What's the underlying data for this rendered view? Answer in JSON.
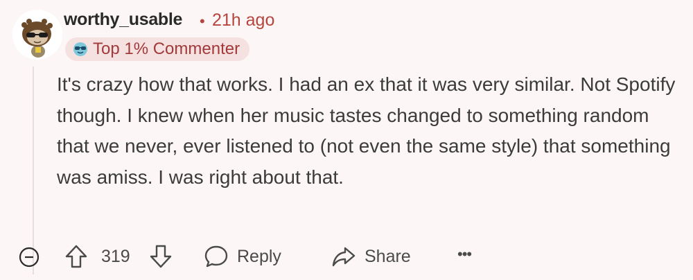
{
  "comment": {
    "username": "worthy_usable",
    "separator": "•",
    "timestamp": "21h ago",
    "flair": {
      "label": "Top 1% Commenter",
      "icon": "sunglasses-emoji-icon"
    },
    "body": "It's crazy how that works. I had an ex that it was very similar. Not Spotify though. I knew when her music tastes changed to something random that we never, ever listened to (not even the same style) that something was amiss. I was right about that."
  },
  "actions": {
    "score": "319",
    "reply_label": "Reply",
    "share_label": "Share",
    "more_label": "•••"
  },
  "colors": {
    "background": "#fcf7f6",
    "accent": "#b5453d",
    "flair_bg": "#f6e1e1",
    "text": "#3b3b3b"
  }
}
